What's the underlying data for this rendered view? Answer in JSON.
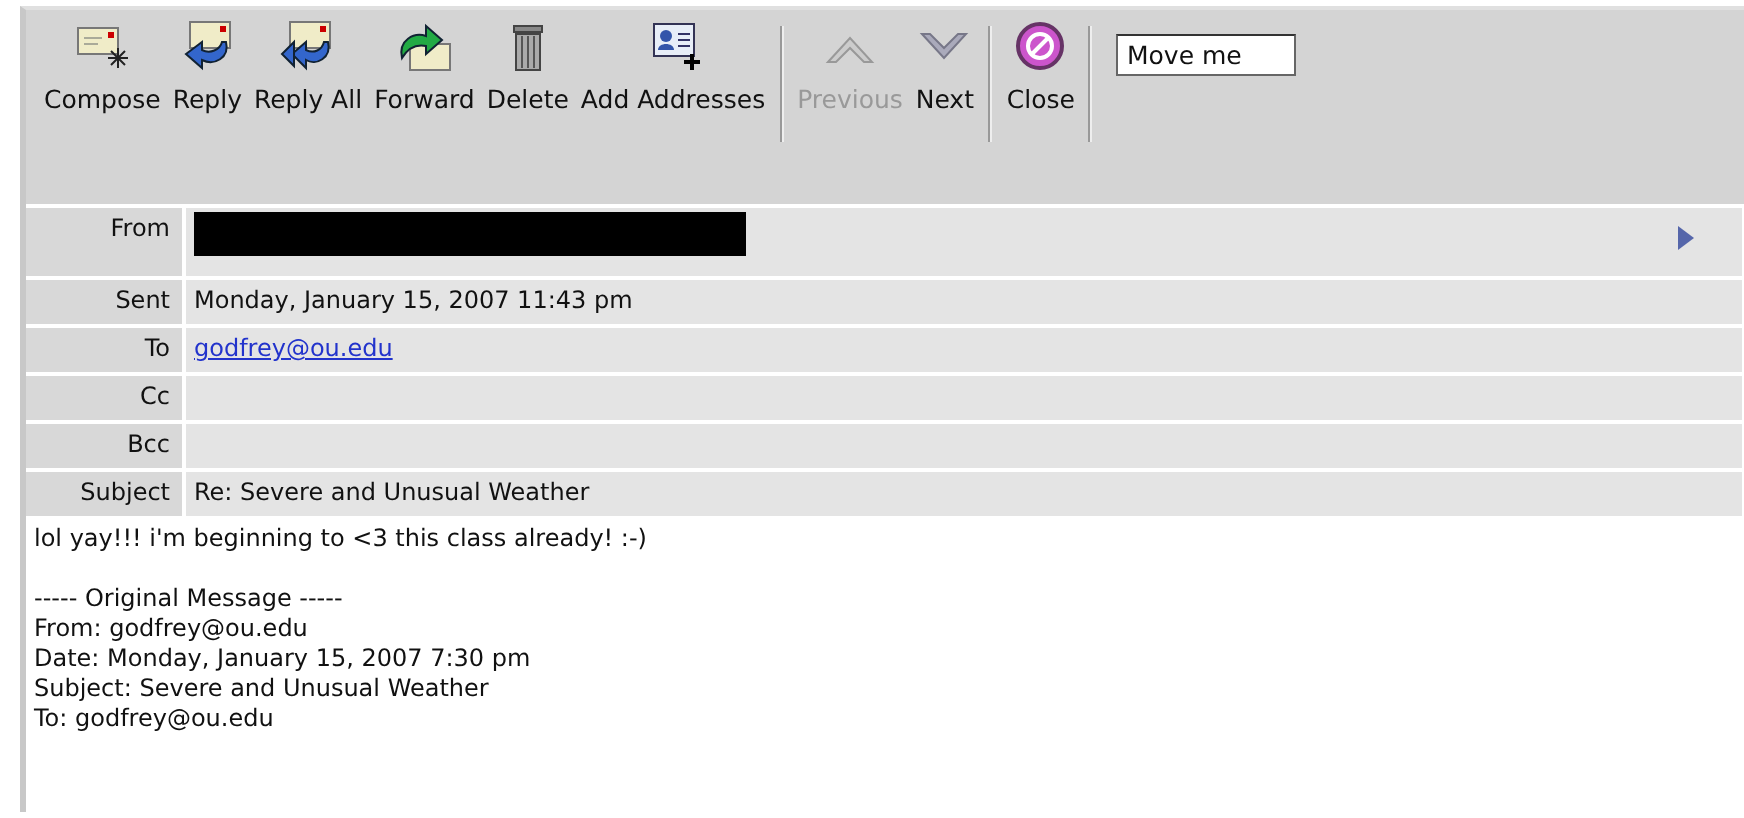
{
  "toolbar": {
    "groups": [
      {
        "buttons": [
          {
            "label": "Compose",
            "kind": "compose",
            "disabled": false
          },
          {
            "label": "Reply",
            "kind": "reply",
            "disabled": false
          },
          {
            "label": "Reply All",
            "kind": "reply-all",
            "disabled": false
          },
          {
            "label": "Forward",
            "kind": "forward",
            "disabled": false
          },
          {
            "label": "Delete",
            "kind": "delete",
            "disabled": false
          },
          {
            "label": "Add Addresses",
            "kind": "add-addresses",
            "disabled": false
          }
        ]
      },
      {
        "buttons": [
          {
            "label": "Previous",
            "kind": "previous",
            "disabled": true
          },
          {
            "label": "Next",
            "kind": "next",
            "disabled": false
          }
        ]
      },
      {
        "buttons": [
          {
            "label": "Close",
            "kind": "close",
            "disabled": false
          }
        ]
      }
    ],
    "move_select": {
      "value": "Move me"
    }
  },
  "headers": [
    {
      "label": "From",
      "kind": "redacted"
    },
    {
      "label": "Sent",
      "kind": "text",
      "value": "Monday, January 15, 2007 11:43 pm"
    },
    {
      "label": "To",
      "kind": "link",
      "value": "godfrey@ou.edu"
    },
    {
      "label": "Cc",
      "kind": "text"
    },
    {
      "label": "Bcc",
      "kind": "text"
    },
    {
      "label": "Subject",
      "kind": "text",
      "value": "Re: Severe and Unusual Weather"
    }
  ],
  "body": {
    "reply": "lol yay!!! i'm beginning to <3 this class already! :-)",
    "lines": [
      "----- Original Message -----",
      "From: godfrey@ou.edu",
      "Date: Monday, January 15, 2007 7:30 pm",
      "Subject: Severe and Unusual Weather",
      "To: godfrey@ou.edu"
    ]
  }
}
